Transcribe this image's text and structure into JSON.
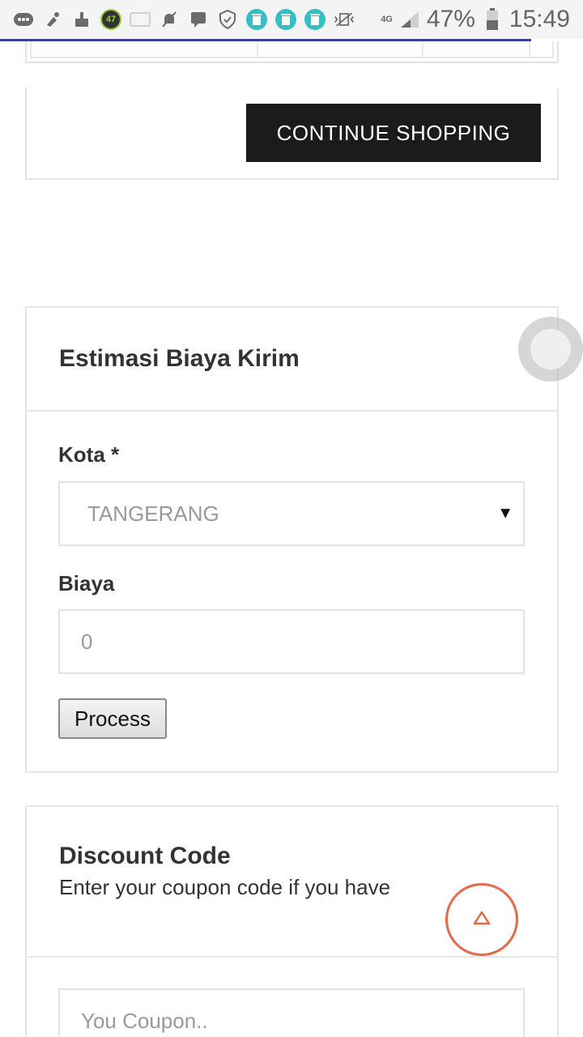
{
  "statusbar": {
    "battery_percent": "47%",
    "time": "15:49",
    "network": "4G",
    "badge_number": "47"
  },
  "cart": {
    "continue_label": "CONTINUE SHOPPING"
  },
  "shipping": {
    "title": "Estimasi Biaya Kirim",
    "city_label": "Kota *",
    "city_value": "TANGERANG",
    "cost_label": "Biaya",
    "cost_placeholder": "0",
    "process_label": "Process"
  },
  "discount": {
    "title": "Discount Code",
    "subtitle": "Enter your coupon code if you have",
    "coupon_placeholder": "You Coupon.."
  },
  "colors": {
    "button_dark": "#1b1b1b",
    "scroll_top_accent": "#e8684a",
    "progress_line": "#3b3f8f"
  }
}
